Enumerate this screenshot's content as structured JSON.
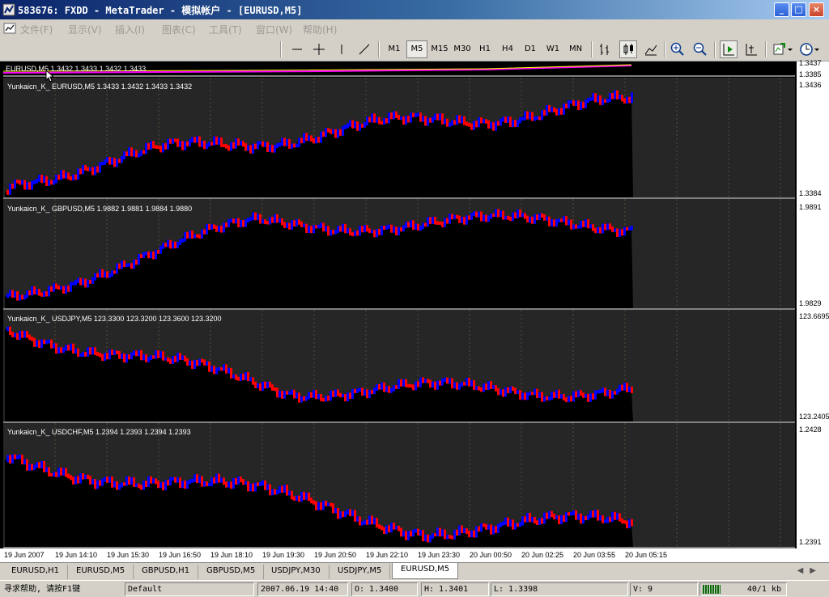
{
  "window": {
    "title": "583676: FXDD - MetaTrader - 模拟帐户 - [EURUSD,M5]",
    "controls": [
      "_",
      "□",
      "×"
    ]
  },
  "menu": {
    "items": [
      "文件(F)",
      "显示(V)",
      "插入(I)",
      "图表(C)",
      "工具(T)",
      "窗口(W)",
      "帮助(H)"
    ]
  },
  "toolbar": {
    "periods": [
      "M1",
      "M5",
      "M15",
      "M30",
      "H1",
      "H4",
      "D1",
      "W1",
      "MN"
    ],
    "active_period": "M5"
  },
  "chart": {
    "main_label": "EURUSD,M5  1.3432 1.3433 1.3432 1.3433",
    "main_scale": [
      "1.3437",
      "1.3385"
    ],
    "panes": [
      {
        "label": "Yunkaicn_K_ EURUSD,M5  1.3433 1.3432 1.3433 1.3432",
        "scale_top": "1.3436",
        "scale_bottom": "1.3384"
      },
      {
        "label": "Yunkaicn_K_ GBPUSD,M5  1.9882 1.9881 1.9884 1.9880",
        "scale_top": "1.9891",
        "scale_bottom": "1.9829"
      },
      {
        "label": "Yunkaicn_K_ USDJPY,M5  123.3300 123.3200 123.3600 123.3200",
        "scale_top": "123.6695",
        "scale_bottom": "123.2405"
      },
      {
        "label": "Yunkaicn_K_ USDCHF,M5  1.2394 1.2393 1.2394 1.2393",
        "scale_top": "1.2428",
        "scale_bottom": "1.2391"
      }
    ],
    "time_axis": [
      "19 Jun 2007",
      "19 Jun 14:10",
      "19 Jun 15:30",
      "19 Jun 16:50",
      "19 Jun 18:10",
      "19 Jun 19:30",
      "19 Jun 20:50",
      "19 Jun 22:10",
      "19 Jun 23:30",
      "20 Jun 00:50",
      "20 Jun 02:25",
      "20 Jun 03:55",
      "20 Jun 05:15"
    ],
    "colors": {
      "up": "#0000ff",
      "down": "#ff0000",
      "background": "#000000",
      "pane_background": "#262626",
      "grid": "#5a4a3a"
    }
  },
  "tabs": {
    "items": [
      "EURUSD,H1",
      "EURUSD,M5",
      "GBPUSD,H1",
      "GBPUSD,M5",
      "USDJPY,M30",
      "USDJPY,M5",
      "EURUSD,M5"
    ],
    "active_index": 6
  },
  "status": {
    "help": "寻求帮助, 请按F1键",
    "profile": "Default",
    "datetime": "2007.06.19 14:40",
    "open": "O: 1.3400",
    "high": "H: 1.3401",
    "low": "L: 1.3398",
    "volume": "V: 9",
    "traffic": "40/1 kb"
  }
}
